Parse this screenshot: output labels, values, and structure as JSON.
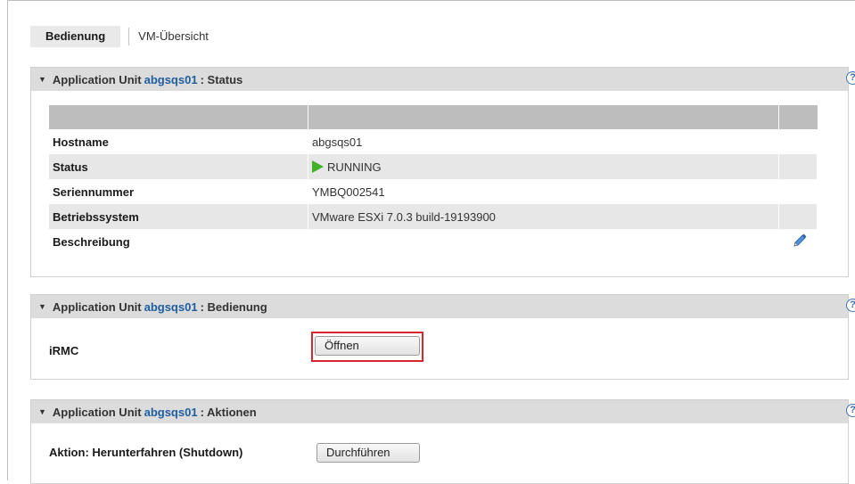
{
  "tabs": [
    {
      "label": "Bedienung",
      "active": true
    },
    {
      "label": "VM-Übersicht",
      "active": false
    }
  ],
  "unit_name": "abgsqs01",
  "panels": {
    "status": {
      "prefix": "Application Unit",
      "suffix": ": Status",
      "rows": [
        {
          "label": "Hostname",
          "value": "abgsqs01"
        },
        {
          "label": "Status",
          "value": "RUNNING",
          "icon": "play-icon",
          "icon_color": "#43b02a"
        },
        {
          "label": "Seriennummer",
          "value": "YMBQ002541"
        },
        {
          "label": "Betriebssystem",
          "value": "VMware ESXi 7.0.3 build-19193900"
        },
        {
          "label": "Beschreibung",
          "value": "",
          "action_icon": "pencil-edit-icon"
        }
      ]
    },
    "bedienung": {
      "prefix": "Application Unit",
      "suffix": ": Bedienung",
      "item_label": "iRMC",
      "button_label": "Öffnen",
      "highlight_color": "#d9262c"
    },
    "aktionen": {
      "prefix": "Application Unit",
      "suffix": ": Aktionen",
      "item_label": "Aktion: Herunterfahren (Shutdown)",
      "button_label": "Durchführen"
    }
  },
  "help_symbol": "?",
  "colors": {
    "link": "#1f5d9f",
    "header_bg": "#dcdcdc",
    "help": "#3c6fb2"
  }
}
